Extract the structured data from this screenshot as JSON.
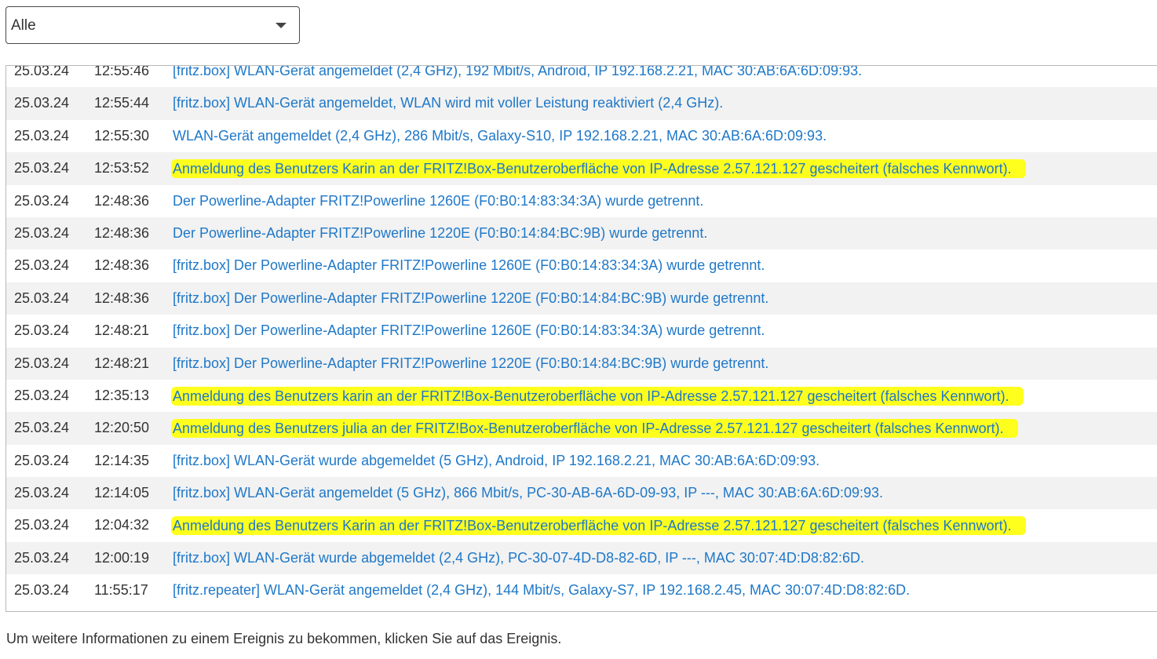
{
  "filter": {
    "selected": "Alle"
  },
  "rows": [
    {
      "date": "25.03.24",
      "time": "12:55:46",
      "message": "[fritz.box] WLAN-Gerät angemeldet (2,4 GHz), 192 Mbit/s, Android, IP 192.168.2.21, MAC 30:AB:6A:6D:09:93.",
      "highlighted": false
    },
    {
      "date": "25.03.24",
      "time": "12:55:44",
      "message": "[fritz.box] WLAN-Gerät angemeldet, WLAN wird mit voller Leistung reaktiviert (2,4 GHz).",
      "highlighted": false
    },
    {
      "date": "25.03.24",
      "time": "12:55:30",
      "message": "WLAN-Gerät angemeldet (2,4 GHz), 286 Mbit/s, Galaxy-S10, IP 192.168.2.21, MAC 30:AB:6A:6D:09:93.",
      "highlighted": false
    },
    {
      "date": "25.03.24",
      "time": "12:53:52",
      "message": "Anmeldung des Benutzers Karin an der FRITZ!Box-Benutzeroberfläche von IP-Adresse 2.57.121.127 gescheitert (falsches Kennwort).",
      "highlighted": true
    },
    {
      "date": "25.03.24",
      "time": "12:48:36",
      "message": "Der Powerline-Adapter FRITZ!Powerline 1260E (F0:B0:14:83:34:3A) wurde getrennt.",
      "highlighted": false
    },
    {
      "date": "25.03.24",
      "time": "12:48:36",
      "message": "Der Powerline-Adapter FRITZ!Powerline 1220E (F0:B0:14:84:BC:9B) wurde getrennt.",
      "highlighted": false
    },
    {
      "date": "25.03.24",
      "time": "12:48:36",
      "message": "[fritz.box] Der Powerline-Adapter FRITZ!Powerline 1260E (F0:B0:14:83:34:3A) wurde getrennt.",
      "highlighted": false
    },
    {
      "date": "25.03.24",
      "time": "12:48:36",
      "message": "[fritz.box] Der Powerline-Adapter FRITZ!Powerline 1220E (F0:B0:14:84:BC:9B) wurde getrennt.",
      "highlighted": false
    },
    {
      "date": "25.03.24",
      "time": "12:48:21",
      "message": "[fritz.box] Der Powerline-Adapter FRITZ!Powerline 1260E (F0:B0:14:83:34:3A) wurde getrennt.",
      "highlighted": false
    },
    {
      "date": "25.03.24",
      "time": "12:48:21",
      "message": "[fritz.box] Der Powerline-Adapter FRITZ!Powerline 1220E (F0:B0:14:84:BC:9B) wurde getrennt.",
      "highlighted": false
    },
    {
      "date": "25.03.24",
      "time": "12:35:13",
      "message": "Anmeldung des Benutzers karin an der FRITZ!Box-Benutzeroberfläche von IP-Adresse 2.57.121.127 gescheitert (falsches Kennwort).",
      "highlighted": true
    },
    {
      "date": "25.03.24",
      "time": "12:20:50",
      "message": "Anmeldung des Benutzers julia an der FRITZ!Box-Benutzeroberfläche von IP-Adresse 2.57.121.127 gescheitert (falsches Kennwort).",
      "highlighted": true
    },
    {
      "date": "25.03.24",
      "time": "12:14:35",
      "message": "[fritz.box] WLAN-Gerät wurde abgemeldet (5 GHz), Android, IP 192.168.2.21, MAC 30:AB:6A:6D:09:93.",
      "highlighted": false
    },
    {
      "date": "25.03.24",
      "time": "12:14:05",
      "message": "[fritz.box] WLAN-Gerät angemeldet (5 GHz), 866 Mbit/s, PC-30-AB-6A-6D-09-93, IP ---, MAC 30:AB:6A:6D:09:93.",
      "highlighted": false
    },
    {
      "date": "25.03.24",
      "time": "12:04:32",
      "message": "Anmeldung des Benutzers Karin an der FRITZ!Box-Benutzeroberfläche von IP-Adresse 2.57.121.127 gescheitert (falsches Kennwort).",
      "highlighted": true
    },
    {
      "date": "25.03.24",
      "time": "12:00:19",
      "message": "[fritz.box] WLAN-Gerät wurde abgemeldet (2,4 GHz), PC-30-07-4D-D8-82-6D, IP ---, MAC 30:07:4D:D8:82:6D.",
      "highlighted": false
    },
    {
      "date": "25.03.24",
      "time": "11:55:17",
      "message": "[fritz.repeater] WLAN-Gerät angemeldet (2,4 GHz), 144 Mbit/s, Galaxy-S7, IP 192.168.2.45, MAC 30:07:4D:D8:82:6D.",
      "highlighted": false
    }
  ],
  "footer": {
    "note": "Um weitere Informationen zu einem Ereignis zu bekommen, klicken Sie auf das Ereignis."
  },
  "colors": {
    "link": "#1f78c8",
    "highlight": "#ffff1e"
  }
}
